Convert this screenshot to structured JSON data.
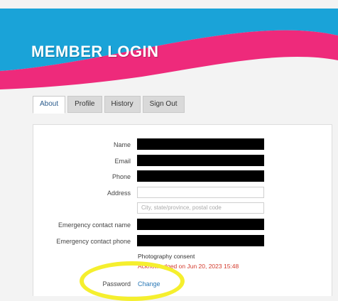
{
  "header": {
    "title": "MEMBER LOGIN"
  },
  "colors": {
    "banner_blue": "#1aa3d8",
    "banner_pink": "#ee2a7b",
    "highlight": "#f5ef2e"
  },
  "tabs": [
    {
      "label": "About",
      "active": true
    },
    {
      "label": "Profile",
      "active": false
    },
    {
      "label": "History",
      "active": false
    },
    {
      "label": "Sign Out",
      "active": false
    }
  ],
  "form": {
    "name_label": "Name",
    "email_label": "Email",
    "phone_label": "Phone",
    "address_label": "Address",
    "address_line2_placeholder": "City, state/province, postal code",
    "emergency_name_label": "Emergency contact name",
    "emergency_phone_label": "Emergency contact phone",
    "photo_consent_label": "Photography consent",
    "photo_consent_status": "Acknowledged on Jun 20, 2023 15:48",
    "password_label": "Password",
    "password_change": "Change"
  }
}
